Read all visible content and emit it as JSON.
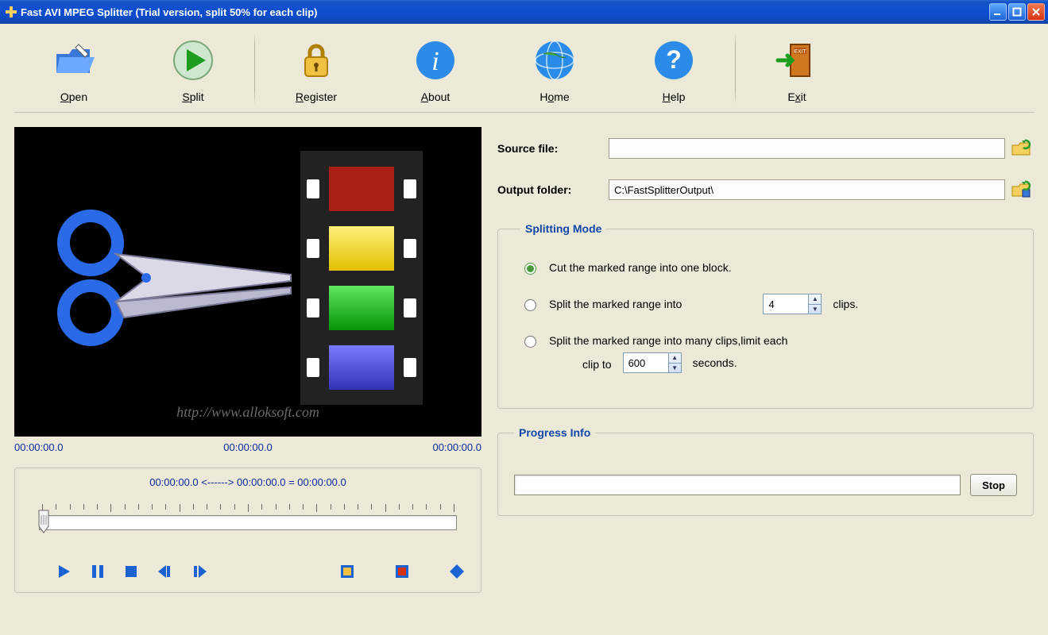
{
  "window": {
    "title": "Fast AVI MPEG Splitter (Trial version, split 50% for each clip)"
  },
  "toolbar": {
    "open": "Open",
    "split": "Split",
    "register": "Register",
    "about": "About",
    "home": "Home",
    "help": "Help",
    "exit": "Exit"
  },
  "preview": {
    "watermark": "http://www.alloksoft.com",
    "time_left": "00:00:00.0",
    "time_center": "00:00:00.0",
    "time_right": "00:00:00.0"
  },
  "range_text": "00:00:00.0 <------> 00:00:00.0 =  00:00:00.0",
  "files": {
    "source_label": "Source file:",
    "source_value": "",
    "output_label": "Output folder:",
    "output_value": "C:\\FastSplitterOutput\\"
  },
  "splitting": {
    "legend": "Splitting Mode",
    "opt1": "Cut the marked range into one block.",
    "opt2_pre": "Split the marked range into",
    "opt2_clips": "4",
    "opt2_post": "clips.",
    "opt3_line1": "Split the marked range into many clips,limit each",
    "opt3_pre2": "clip to",
    "opt3_seconds": "600",
    "opt3_post": "seconds."
  },
  "progress": {
    "legend": "Progress Info",
    "stop": "Stop"
  }
}
